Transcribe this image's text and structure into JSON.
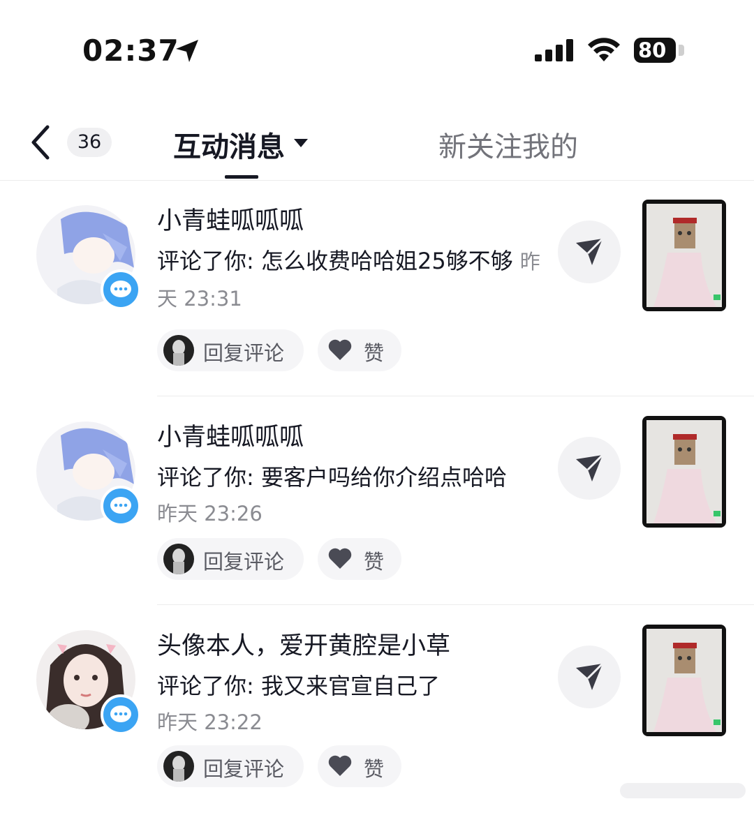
{
  "status": {
    "time": "02:37",
    "battery": "80"
  },
  "header": {
    "badge_count": "36",
    "tab_active": "互动消息",
    "tab_inactive": "新关注我的"
  },
  "messages": [
    {
      "name": "小青蛙呱呱呱",
      "comment": "评论了你: 怎么收费哈哈姐25够不够",
      "time": "昨天 23:31",
      "reply_label": "回复评论",
      "like_label": "赞"
    },
    {
      "name": "小青蛙呱呱呱",
      "comment": "评论了你: 要客户吗给你介绍点哈哈",
      "time": "昨天 23:26",
      "reply_label": "回复评论",
      "like_label": "赞"
    },
    {
      "name": "头像本人，爱开黄腔是小草",
      "comment": "评论了你: 我又来官宣自己了",
      "time": "昨天 23:22",
      "reply_label": "回复评论",
      "like_label": "赞"
    }
  ],
  "icons": {
    "back": "back-chevron-icon",
    "caret": "caret-down-icon",
    "send": "send-icon",
    "comment_badge": "comment-bubble-icon",
    "like": "heart-icon"
  },
  "colors": {
    "badge_blue": "#3ba4f3",
    "text_primary": "#161823",
    "text_secondary": "#8a8b91"
  }
}
